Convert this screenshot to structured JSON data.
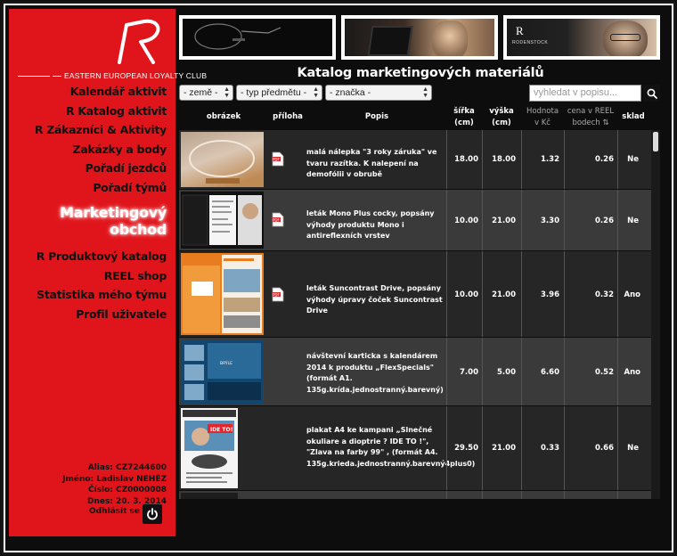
{
  "sidebar": {
    "tagline": "EASTERN EUROPEAN LOYALTY CLUB",
    "nav": [
      {
        "label": "Kalendář aktivit"
      },
      {
        "label": "R Katalog aktivit"
      },
      {
        "label": "R Zákazníci & Aktivity"
      },
      {
        "label": "Zakázky a body"
      },
      {
        "label": "Pořadí jezdců"
      },
      {
        "label": "Pořadí týmů"
      }
    ],
    "active": [
      "Marketingový",
      "obchod"
    ],
    "nav2": [
      {
        "label": "R Produktový katalog"
      },
      {
        "label": "REEL shop"
      },
      {
        "label": "Statistika mého týmu"
      },
      {
        "label": "Profil uživatele"
      }
    ],
    "user": {
      "alias": "Alias: CZ7244600",
      "name": "Jméno: Ladislav NEHÉZ",
      "number": "Číslo: CZ0000008",
      "date": "Dnes: 20. 3. 2014"
    },
    "logout": "Odhlásit se"
  },
  "banners": {
    "b3_text": "RODENSTOCK"
  },
  "title": "Katalog marketingových materiálů",
  "filters": {
    "country": "- země -",
    "type": "- typ předmětu -",
    "brand": "- značka -",
    "search_placeholder": "vyhledat v popisu..."
  },
  "columns": {
    "image": "obrázek",
    "attachment": "příloha",
    "description": "Popis",
    "width": [
      "šířka",
      "(cm)"
    ],
    "height": [
      "výška",
      "(cm)"
    ],
    "value": [
      "Hodnota",
      "v Kč"
    ],
    "price": [
      "cena v REEL",
      "bodech"
    ],
    "stock": "sklad"
  },
  "rows": [
    {
      "desc": "malá nálepka \"3 roky záruka\" ve tvaru razítka. K nalepení na demofólii v obrubě",
      "width": "18.00",
      "height": "18.00",
      "value": "1.32",
      "price": "0.26",
      "stock": "Ne"
    },
    {
      "desc": "leták Mono Plus cocky, popsány výhody produktu Mono i antireflexních vrstev",
      "width": "10.00",
      "height": "21.00",
      "value": "3.30",
      "price": "0.26",
      "stock": "Ne"
    },
    {
      "desc": "leták Suncontrast Drive, popsány výhody úpravy čoček Suncontrast Drive",
      "width": "10.00",
      "height": "21.00",
      "value": "3.96",
      "price": "0.32",
      "stock": "Ano"
    },
    {
      "desc": "návštevní karticka s kalendárem 2014 k produktu „FlexSpecials\" (formát A1. 135g.krída.jednostranný.barevný)",
      "width": "7.00",
      "height": "5.00",
      "value": "6.60",
      "price": "0.52",
      "stock": "Ano"
    },
    {
      "desc": "plakat A4 ke kampani „Slnečné okuliare a dioptrie ? IDE TO !\", \"Zlava na farby 99\" , (formát A4. 135g.krieda.jednostranný.barevný4plus0)",
      "width": "29.50",
      "height": "21.00",
      "value": "0.33",
      "price": "0.66",
      "stock": "Ne"
    }
  ],
  "colors": {
    "sidebar_red": "#e0151b",
    "background": "#0d0d0d"
  }
}
